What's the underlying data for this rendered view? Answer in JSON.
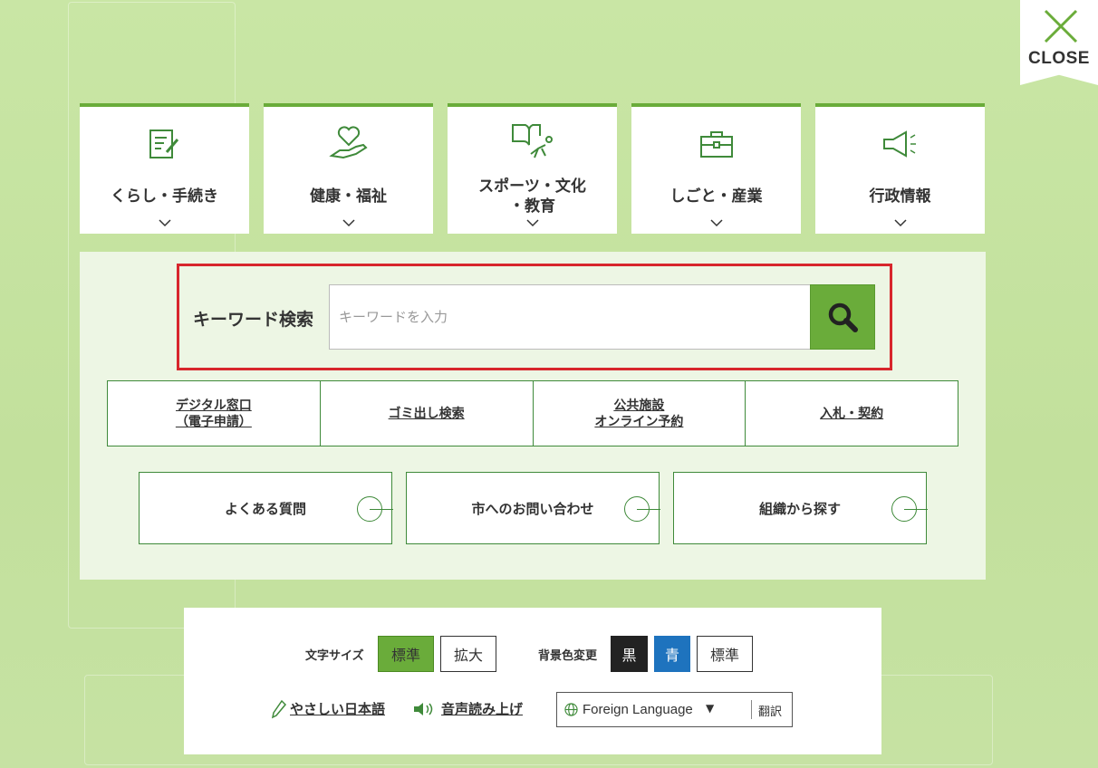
{
  "close": {
    "label": "CLOSE",
    "icon": "close-x-icon"
  },
  "categories": [
    {
      "label": "くらし・手続き",
      "icon": "document-pen-icon"
    },
    {
      "label": "健康・福祉",
      "icon": "heart-hand-icon"
    },
    {
      "label_line1": "スポーツ・文化",
      "label_line2": "・教育",
      "icon": "book-runner-icon"
    },
    {
      "label": "しごと・産業",
      "icon": "briefcase-icon"
    },
    {
      "label": "行政情報",
      "icon": "megaphone-icon"
    }
  ],
  "search": {
    "label": "キーワード検索",
    "placeholder": "キーワードを入力",
    "icon": "search-icon"
  },
  "quick_links": [
    {
      "line1": "デジタル窓口",
      "line2": "（電子申請）"
    },
    {
      "line1": "ゴミ出し検索",
      "line2": ""
    },
    {
      "line1": "公共施設",
      "line2": "オンライン予約"
    },
    {
      "line1": "入札・契約",
      "line2": ""
    }
  ],
  "buttons": [
    {
      "label": "よくある質問"
    },
    {
      "label": "市へのお問い合わせ"
    },
    {
      "label": "組織から探す"
    }
  ],
  "accessibility": {
    "font_size_label": "文字サイズ",
    "font_standard": "標準",
    "font_large": "拡大",
    "bg_label": "背景色変更",
    "bg_black": "黒",
    "bg_blue": "青",
    "bg_standard": "標準",
    "easy_japanese": "やさしい日本語",
    "voice": "音声読み上げ",
    "language": "Foreign Language",
    "language_arrow": "▼",
    "translate": "翻訳"
  },
  "colors": {
    "accent": "#6aac3a",
    "highlight_border": "#d7262c",
    "blue": "#1e73be",
    "black": "#222222"
  }
}
